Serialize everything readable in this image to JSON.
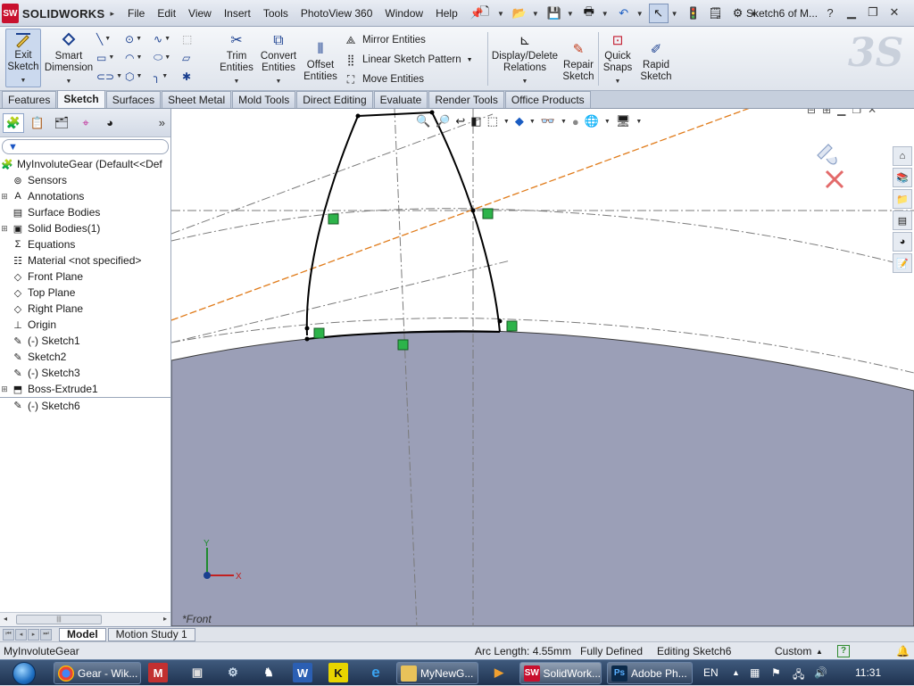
{
  "app": {
    "logo_badge": "SW",
    "logo_text": "SOLIDWORKS",
    "doc_title": "Sketch6 of M...",
    "menu": [
      "File",
      "Edit",
      "View",
      "Insert",
      "Tools",
      "PhotoView 360",
      "Window",
      "Help"
    ]
  },
  "ribbon": {
    "exit_sketch": [
      "Exit",
      "Sketch"
    ],
    "smart_dimension": [
      "Smart",
      "Dimension"
    ],
    "trim_entities": [
      "Trim",
      "Entities"
    ],
    "convert_entities": [
      "Convert",
      "Entities"
    ],
    "offset_entities": [
      "Offset",
      "Entities"
    ],
    "mirror_entities": "Mirror Entities",
    "linear_sketch_pattern": "Linear Sketch Pattern",
    "move_entities": "Move Entities",
    "display_delete_relations": [
      "Display/Delete",
      "Relations"
    ],
    "repair_sketch": [
      "Repair",
      "Sketch"
    ],
    "quick_snaps": [
      "Quick",
      "Snaps"
    ],
    "rapid_sketch": [
      "Rapid",
      "Sketch"
    ]
  },
  "tabs": [
    "Features",
    "Sketch",
    "Surfaces",
    "Sheet Metal",
    "Mold Tools",
    "Direct Editing",
    "Evaluate",
    "Render Tools",
    "Office Products"
  ],
  "tabs_active": "Sketch",
  "tree": {
    "root": "MyInvoluteGear  (Default<<Def",
    "items": [
      {
        "label": "Sensors",
        "icon": "sensor-icon",
        "expandable": false
      },
      {
        "label": "Annotations",
        "icon": "annotations-icon",
        "expandable": true
      },
      {
        "label": "Surface Bodies",
        "icon": "surface-bodies-icon",
        "expandable": false
      },
      {
        "label": "Solid Bodies(1)",
        "icon": "solid-bodies-icon",
        "expandable": true
      },
      {
        "label": "Equations",
        "icon": "equations-icon",
        "expandable": false
      },
      {
        "label": "Material <not specified>",
        "icon": "material-icon",
        "expandable": false
      },
      {
        "label": "Front Plane",
        "icon": "plane-icon",
        "expandable": false
      },
      {
        "label": "Top Plane",
        "icon": "plane-icon",
        "expandable": false
      },
      {
        "label": "Right Plane",
        "icon": "plane-icon",
        "expandable": false
      },
      {
        "label": "Origin",
        "icon": "origin-icon",
        "expandable": false
      },
      {
        "label": "(-) Sketch1",
        "icon": "sketch-icon",
        "expandable": false
      },
      {
        "label": "Sketch2",
        "icon": "sketch-icon",
        "expandable": false
      },
      {
        "label": "(-) Sketch3",
        "icon": "sketch-icon",
        "expandable": false
      },
      {
        "label": "Boss-Extrude1",
        "icon": "extrude-icon",
        "expandable": true
      },
      {
        "label": "(-) Sketch6",
        "icon": "sketch-icon",
        "expandable": false
      }
    ]
  },
  "viewport": {
    "view_label": "*Front",
    "axis_y": "Y",
    "axis_x": "X"
  },
  "bottom_tabs": [
    "Model",
    "Motion Study 1"
  ],
  "status": {
    "doc": "MyInvoluteGear",
    "arc_length": "Arc Length: 4.55mm",
    "defined": "Fully Defined",
    "editing": "Editing Sketch6",
    "units": "Custom",
    "help": "?"
  },
  "taskbar": {
    "buttons": [
      "Gear - Wik...",
      "MyNewG...",
      "SolidWork...",
      "Adobe Ph..."
    ],
    "lang": "EN",
    "time": "11:31"
  },
  "colors": {
    "part_fill": "#9b9fb7",
    "sketch_line": "#000000",
    "construction": "#7a7a7a",
    "orange_line": "#e07b1a",
    "relation_badge": "#2db34a"
  }
}
